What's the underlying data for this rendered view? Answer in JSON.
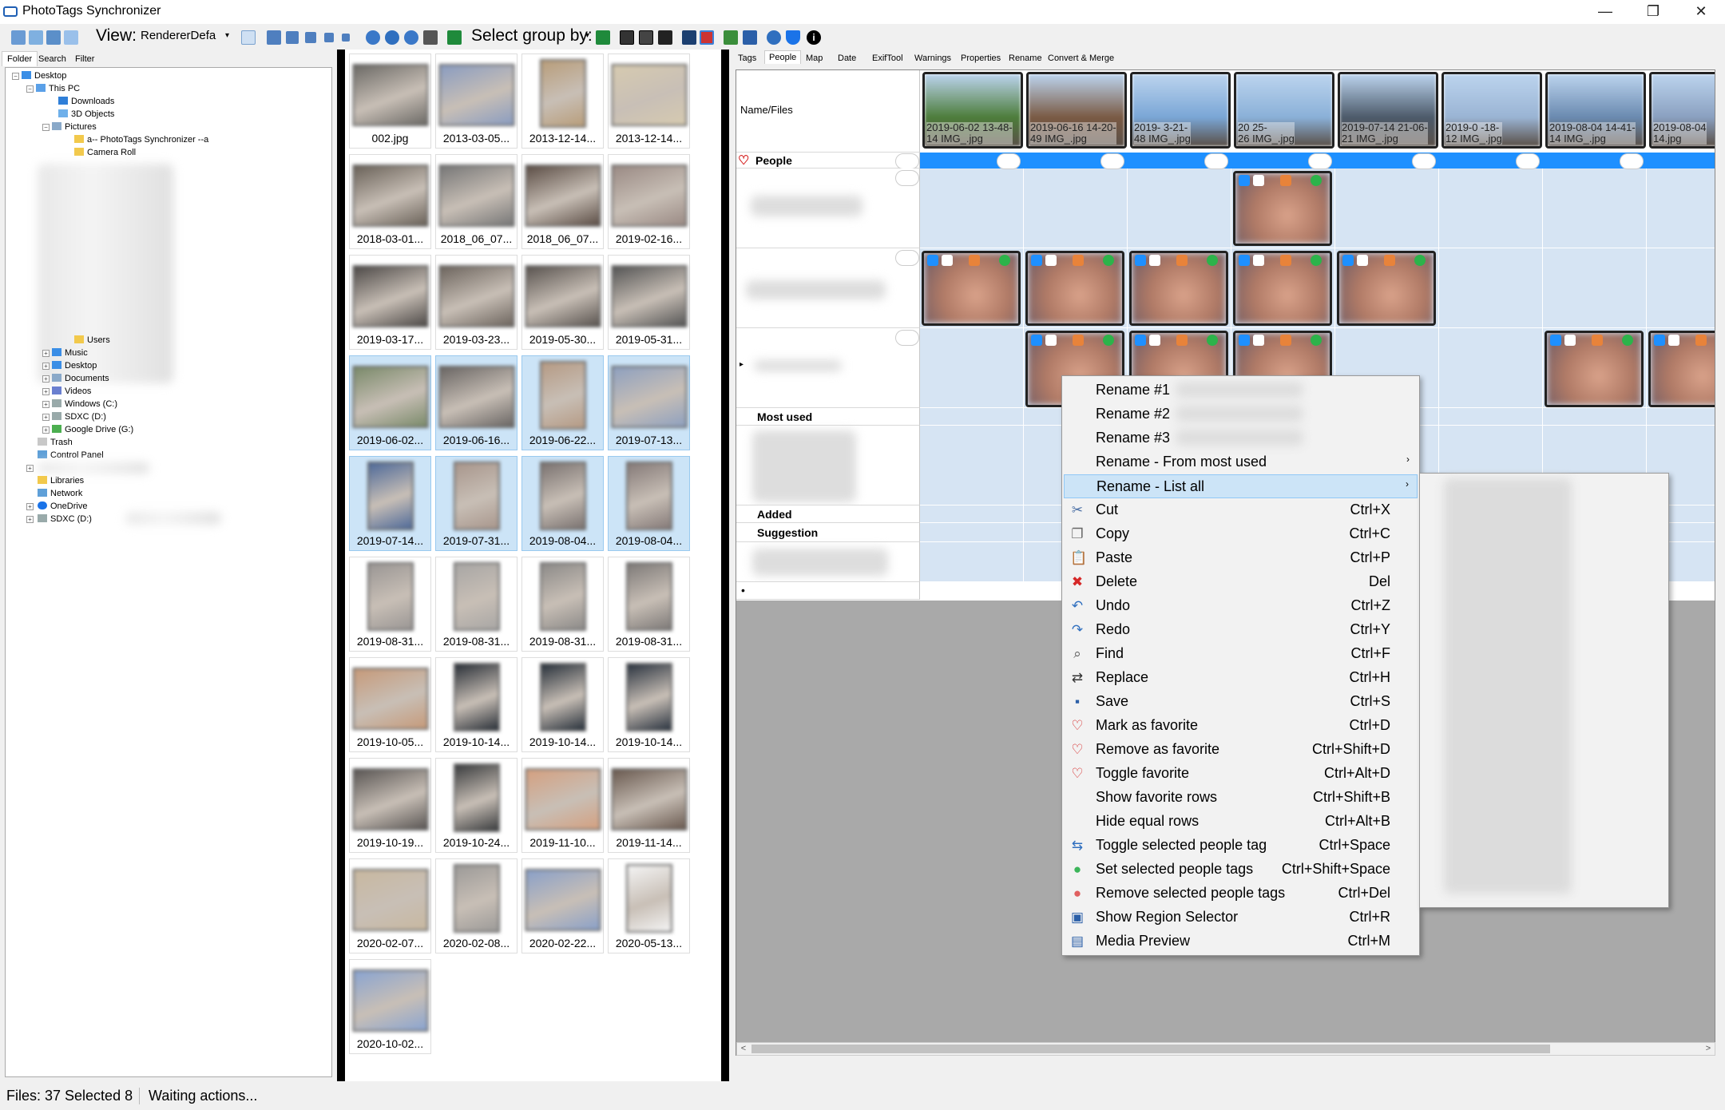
{
  "window": {
    "title": "PhotoTags Synchronizer",
    "minimize": "—",
    "maximize": "❐",
    "close": "✕"
  },
  "toolbar": {
    "view_label": "View:",
    "renderer_value": "RendererDefa",
    "group_label": "Select group by:"
  },
  "left_tabs": [
    "Folder",
    "Search",
    "Filter"
  ],
  "tree": [
    {
      "label": "Desktop"
    },
    {
      "label": "This PC"
    },
    {
      "label": "Downloads"
    },
    {
      "label": "3D Objects"
    },
    {
      "label": "Pictures"
    },
    {
      "label": "a-- PhotoTags Synchronizer --a"
    },
    {
      "label": "Camera Roll"
    },
    {
      "label": "Users"
    },
    {
      "label": "Music"
    },
    {
      "label": "Desktop"
    },
    {
      "label": "Documents"
    },
    {
      "label": "Videos"
    },
    {
      "label": "Windows (C:)"
    },
    {
      "label": "SDXC (D:)"
    },
    {
      "label": "Google Drive (G:)"
    },
    {
      "label": "Trash"
    },
    {
      "label": "Control Panel"
    },
    {
      "label": "Libraries"
    },
    {
      "label": "Network"
    },
    {
      "label": "OneDrive"
    },
    {
      "label": "SDXC (D:)"
    }
  ],
  "thumbnails": [
    {
      "caption": "002.jpg"
    },
    {
      "caption": "2013-03-05..."
    },
    {
      "caption": "2013-12-14..."
    },
    {
      "caption": "2013-12-14..."
    },
    {
      "caption": "2018-03-01..."
    },
    {
      "caption": "2018_06_07..."
    },
    {
      "caption": "2018_06_07..."
    },
    {
      "caption": "2019-02-16..."
    },
    {
      "caption": "2019-03-17..."
    },
    {
      "caption": "2019-03-23..."
    },
    {
      "caption": "2019-05-30..."
    },
    {
      "caption": "2019-05-31..."
    },
    {
      "caption": "2019-06-02..."
    },
    {
      "caption": "2019-06-16..."
    },
    {
      "caption": "2019-06-22..."
    },
    {
      "caption": "2019-07-13..."
    },
    {
      "caption": "2019-07-14..."
    },
    {
      "caption": "2019-07-31..."
    },
    {
      "caption": "2019-08-04..."
    },
    {
      "caption": "2019-08-04..."
    },
    {
      "caption": "2019-08-31..."
    },
    {
      "caption": "2019-08-31..."
    },
    {
      "caption": "2019-08-31..."
    },
    {
      "caption": "2019-08-31..."
    },
    {
      "caption": "2019-10-05..."
    },
    {
      "caption": "2019-10-14..."
    },
    {
      "caption": "2019-10-14..."
    },
    {
      "caption": "2019-10-14..."
    },
    {
      "caption": "2019-10-19..."
    },
    {
      "caption": "2019-10-24..."
    },
    {
      "caption": "2019-11-10..."
    },
    {
      "caption": "2019-11-14..."
    },
    {
      "caption": "2020-02-07..."
    },
    {
      "caption": "2020-02-08..."
    },
    {
      "caption": "2020-02-22..."
    },
    {
      "caption": "2020-05-13..."
    },
    {
      "caption": "2020-10-02..."
    }
  ],
  "right_tabs": [
    "Tags",
    "People",
    "Map",
    "Date",
    "ExifTool",
    "Warnings",
    "Properties",
    "Rename",
    "Convert & Merge"
  ],
  "grid": {
    "name_files_header": "Name/Files",
    "columns": [
      {
        "line1": "2019-06-02 13-48-",
        "line2": "14 IMG_.jpg"
      },
      {
        "line1": "2019-06-16 14-20-",
        "line2": "49 IMG_.jpg"
      },
      {
        "line1": "2019-        3-21-",
        "line2": "48 IMG_.jpg"
      },
      {
        "line1": "20            25-",
        "line2": "26 IMG_.jpg"
      },
      {
        "line1": "2019-07-14 21-06-",
        "line2": "21 IMG_.jpg"
      },
      {
        "line1": "2019-0       -18-",
        "line2": "12 IMG_.jpg"
      },
      {
        "line1": "2019-08-04 14-41-",
        "line2": "14 IMG_.jpg"
      },
      {
        "line1": "2019-08-04",
        "line2": "14.jpg"
      }
    ],
    "rows": {
      "people": "People",
      "most_used": "Most used",
      "added": "Added",
      "suggestion": "Suggestion",
      "new_row": "•",
      "expand": "▸"
    }
  },
  "status": {
    "files": "Files: 37 Selected 8",
    "state": "Waiting actions..."
  },
  "context_menu": [
    {
      "label": "Rename #1",
      "shortcut": "",
      "icon": "none"
    },
    {
      "label": "Rename #2",
      "shortcut": "",
      "icon": "none"
    },
    {
      "label": "Rename #3",
      "shortcut": "",
      "icon": "none"
    },
    {
      "label": "Rename - From most used",
      "shortcut": "",
      "icon": "none",
      "submenu": "›"
    },
    {
      "label": "Rename - List all",
      "shortcut": "",
      "icon": "none",
      "submenu": "›"
    },
    {
      "label": "Cut",
      "shortcut": "Ctrl+X",
      "icon": "scissors-icon"
    },
    {
      "label": "Copy",
      "shortcut": "Ctrl+C",
      "icon": "copy-icon"
    },
    {
      "label": "Paste",
      "shortcut": "Ctrl+P",
      "icon": "paste-icon"
    },
    {
      "label": "Delete",
      "shortcut": "Del",
      "icon": "delete-icon"
    },
    {
      "label": "Undo",
      "shortcut": "Ctrl+Z",
      "icon": "undo-icon"
    },
    {
      "label": "Redo",
      "shortcut": "Ctrl+Y",
      "icon": "redo-icon"
    },
    {
      "label": "Find",
      "shortcut": "Ctrl+F",
      "icon": "find-icon"
    },
    {
      "label": "Replace",
      "shortcut": "Ctrl+H",
      "icon": "replace-icon"
    },
    {
      "label": "Save",
      "shortcut": "Ctrl+S",
      "icon": "save-icon"
    },
    {
      "label": "Mark as favorite",
      "shortcut": "Ctrl+D",
      "icon": "heart-icon"
    },
    {
      "label": "Remove as favorite",
      "shortcut": "Ctrl+Shift+D",
      "icon": "heart-icon"
    },
    {
      "label": "Toggle favorite",
      "shortcut": "Ctrl+Alt+D",
      "icon": "heart-icon"
    },
    {
      "label": "Show favorite rows",
      "shortcut": "Ctrl+Shift+B",
      "icon": "none"
    },
    {
      "label": "Hide equal rows",
      "shortcut": "Ctrl+Alt+B",
      "icon": "none"
    },
    {
      "label": "Toggle selected people tag",
      "shortcut": "Ctrl+Space",
      "icon": "toggle-icon"
    },
    {
      "label": "Set selected people tags",
      "shortcut": "Ctrl+Shift+Space",
      "icon": "green-dot-icon"
    },
    {
      "label": "Remove selected people tags",
      "shortcut": "Ctrl+Del",
      "icon": "red-dot-icon"
    },
    {
      "label": "Show Region Selector",
      "shortcut": "Ctrl+R",
      "icon": "region-icon"
    },
    {
      "label": "Media Preview",
      "shortcut": "Ctrl+M",
      "icon": "preview-icon"
    }
  ],
  "colors": {
    "accent": "#1e90ff",
    "selection": "#cce4f7",
    "people_header": "#1e90ff",
    "cell": "#d6e4f3"
  }
}
